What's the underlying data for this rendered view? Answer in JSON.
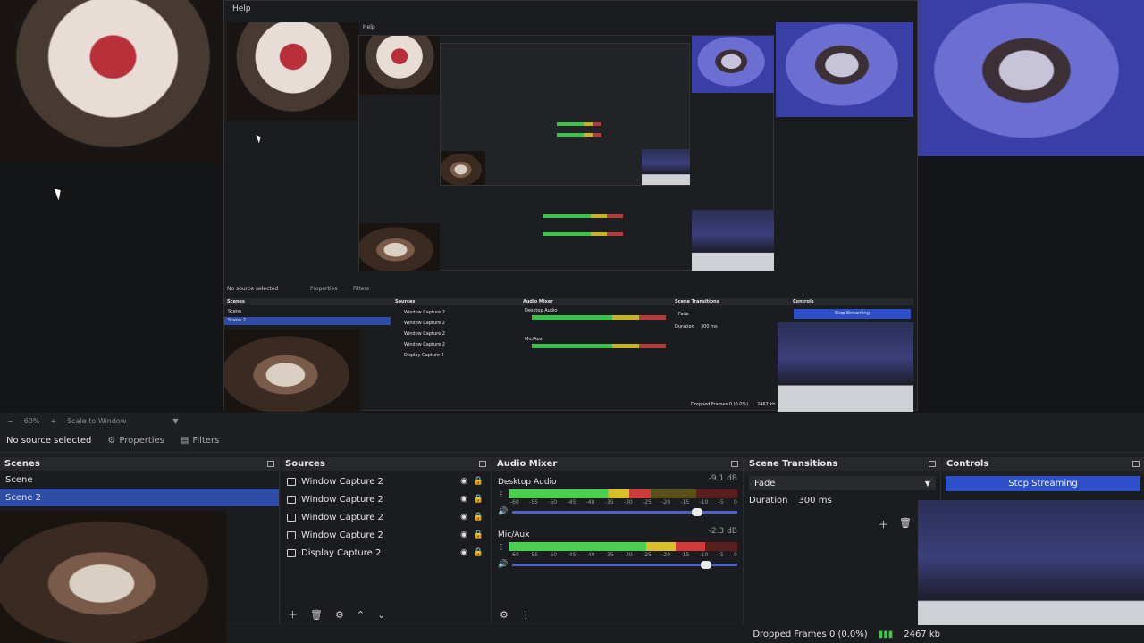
{
  "preview": {
    "menu_help": "Help",
    "nested_menu_help": "Help",
    "nested_no_source": "No source selected",
    "nested_properties": "Properties",
    "nested_filters": "Filters",
    "nested_scenes_title": "Scenes",
    "nested_sources_title": "Sources",
    "nested_mixer_title": "Audio Mixer",
    "nested_trans_title": "Scene Transitions",
    "nested_controls_title": "Controls",
    "nested_stop": "Stop Streaming",
    "nested_scene_1": "Scene",
    "nested_scene_2": "Scene 2",
    "nested_source_1": "Window Capture 2",
    "nested_source_2": "Window Capture 2",
    "nested_source_3": "Window Capture 2",
    "nested_source_4": "Window Capture 2",
    "nested_source_5": "Display Capture 2",
    "nested_desktop": "Desktop Audio",
    "nested_mic": "Mic/Aux",
    "nested_fade": "Fade",
    "nested_duration": "Duration",
    "nested_ms": "300 ms",
    "nested_dropped": "Dropped Frames 0 (0.0%)",
    "nested_kbps": "2467 kb"
  },
  "zoombar": {
    "minus": "−",
    "zoom": "60%",
    "plus": "+",
    "scale_mode": "Scale to Window"
  },
  "context": {
    "no_source": "No source selected",
    "properties": "Properties",
    "filters": "Filters"
  },
  "scenes": {
    "title": "Scenes",
    "items": [
      {
        "label": "Scene",
        "selected": false
      },
      {
        "label": "Scene 2",
        "selected": true
      }
    ]
  },
  "sources": {
    "title": "Sources",
    "items": [
      {
        "label": "Window Capture 2"
      },
      {
        "label": "Window Capture 2"
      },
      {
        "label": "Window Capture 2"
      },
      {
        "label": "Window Capture 2"
      },
      {
        "label": "Display Capture 2"
      }
    ]
  },
  "mixer": {
    "title": "Audio Mixer",
    "channels": [
      {
        "name": "Desktop Audio",
        "db": "-9.1 dB",
        "level": 0.62,
        "volume": 0.82
      },
      {
        "name": "Mic/Aux",
        "db": "-2.3 dB",
        "level": 0.86,
        "volume": 0.86
      }
    ],
    "scale": [
      "-60",
      "-55",
      "-50",
      "-45",
      "-40",
      "-35",
      "-30",
      "-25",
      "-20",
      "-15",
      "-10",
      "-5",
      "0"
    ]
  },
  "transitions": {
    "title": "Scene Transitions",
    "selected": "Fade",
    "duration_label": "Duration",
    "duration_value": "300 ms"
  },
  "controls": {
    "title": "Controls",
    "stop_streaming": "Stop Streaming"
  },
  "status": {
    "dropped_frames": "Dropped Frames 0 (0.0%)",
    "bitrate": "2467 kb"
  },
  "colors": {
    "accent": "#2d4fc9",
    "selection": "#2f4da8",
    "meter_green": "#4ad04e",
    "meter_yellow": "#d8c025",
    "meter_red": "#d23a3a"
  }
}
